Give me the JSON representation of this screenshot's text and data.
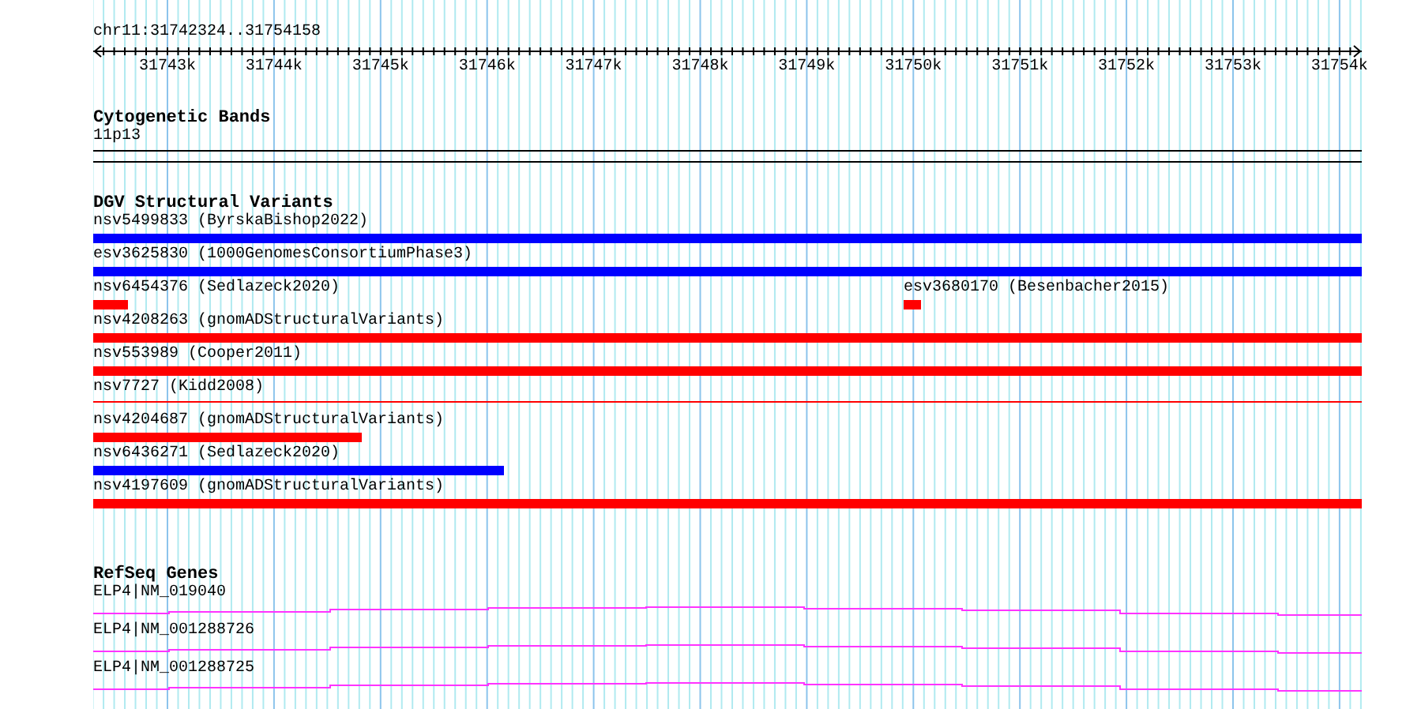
{
  "location": "chr11:31742324..31754158",
  "ruler": {
    "ticks": [
      "31743k",
      "31744k",
      "31745k",
      "31746k",
      "31747k",
      "31748k",
      "31749k",
      "31750k",
      "31751k",
      "31752k",
      "31753k",
      "31754k"
    ]
  },
  "cytogenetic_bands": {
    "title": "Cytogenetic Bands",
    "band": "11p13"
  },
  "dgv": {
    "title": "DGV Structural Variants",
    "rows": [
      {
        "features": [
          {
            "label": "nsv5499833 (ByrskaBishop2022)",
            "color": "#0000ff",
            "kind": "bar"
          }
        ]
      },
      {
        "features": [
          {
            "label": "esv3625830 (1000GenomesConsortiumPhase3)",
            "color": "#0000ff",
            "kind": "bar"
          }
        ]
      },
      {
        "features": [
          {
            "label": "nsv6454376 (Sedlazeck2020)",
            "color": "#ff0000",
            "kind": "bar"
          },
          {
            "label": "esv3680170 (Besenbacher2015)",
            "color": "#ff0000",
            "kind": "bar"
          }
        ]
      },
      {
        "features": [
          {
            "label": "nsv4208263 (gnomADStructuralVariants)",
            "color": "#ff0000",
            "kind": "bar"
          }
        ]
      },
      {
        "features": [
          {
            "label": "nsv553989 (Cooper2011)",
            "color": "#ff0000",
            "kind": "bar"
          }
        ]
      },
      {
        "features": [
          {
            "label": "nsv7727 (Kidd2008)",
            "color": "#ff0000",
            "kind": "line"
          }
        ]
      },
      {
        "features": [
          {
            "label": "nsv4204687 (gnomADStructuralVariants)",
            "color": "#ff0000",
            "kind": "bar"
          }
        ]
      },
      {
        "features": [
          {
            "label": "nsv6436271 (Sedlazeck2020)",
            "color": "#0000ff",
            "kind": "bar"
          }
        ]
      },
      {
        "features": [
          {
            "label": "nsv4197609 (gnomADStructuralVariants)",
            "color": "#ff0000",
            "kind": "bar"
          }
        ]
      }
    ]
  },
  "refseq": {
    "title": "RefSeq Genes",
    "genes": [
      {
        "label": "ELP4|NM_019040"
      },
      {
        "label": "ELP4|NM_001288726"
      },
      {
        "label": "ELP4|NM_001288725"
      }
    ]
  }
}
